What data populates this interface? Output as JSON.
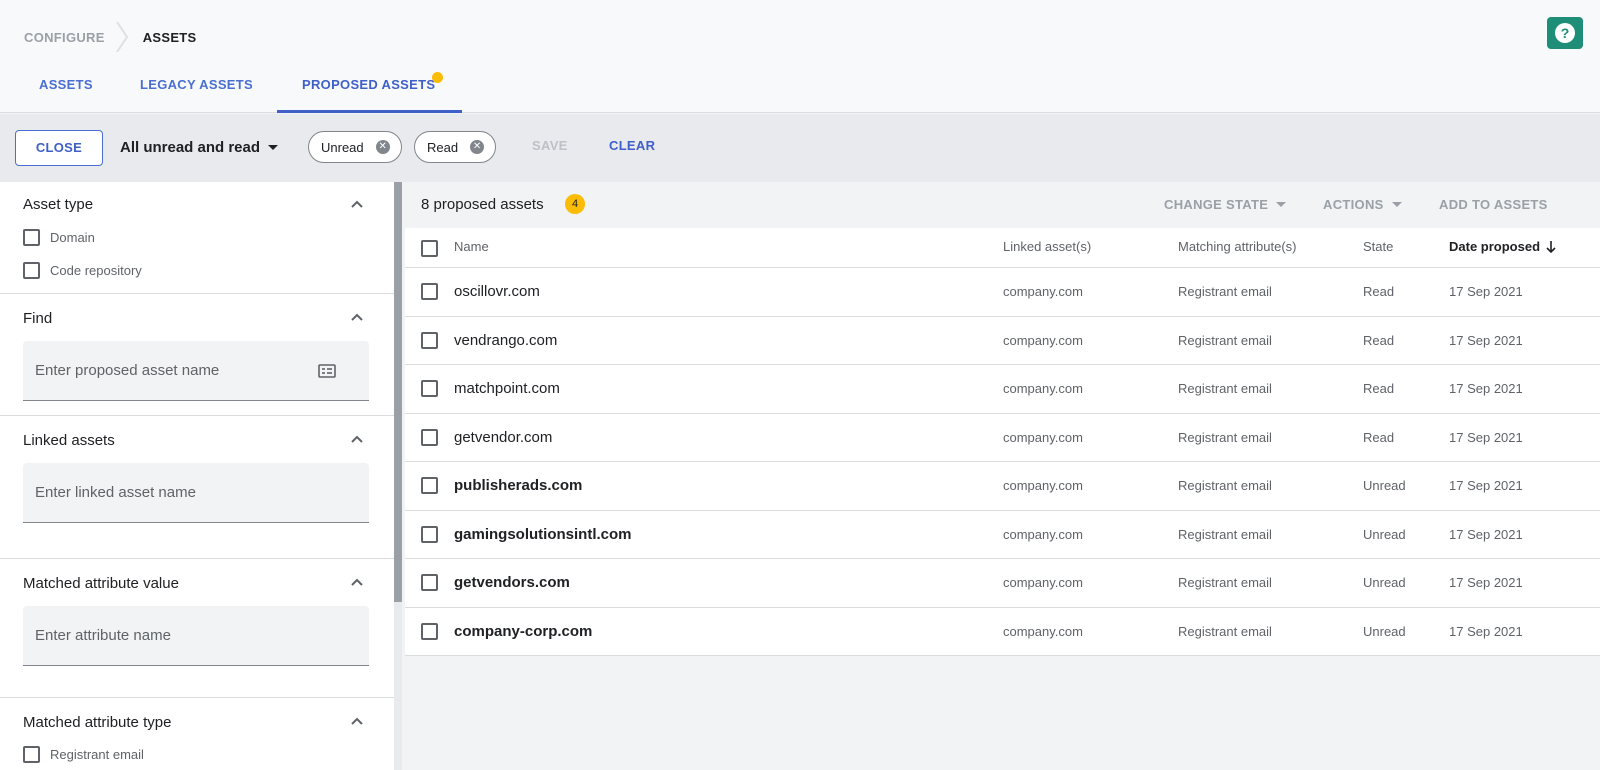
{
  "breadcrumb": {
    "parent": "CONFIGURE",
    "current": "ASSETS"
  },
  "help_label": "?",
  "tabs": [
    {
      "label": "ASSETS"
    },
    {
      "label": "LEGACY ASSETS"
    },
    {
      "label": "PROPOSED ASSETS",
      "active": true,
      "has_notification": true
    }
  ],
  "toolbar": {
    "close_label": "CLOSE",
    "filter_label": "All unread and read",
    "chips": [
      {
        "label": "Unread"
      },
      {
        "label": "Read"
      }
    ],
    "save_label": "SAVE",
    "clear_label": "CLEAR"
  },
  "sidebar": {
    "asset_type": {
      "title": "Asset type",
      "options": [
        "Domain",
        "Code repository"
      ]
    },
    "find": {
      "title": "Find",
      "placeholder": "Enter proposed asset name"
    },
    "linked": {
      "title": "Linked assets",
      "placeholder": "Enter linked asset name"
    },
    "matched_value": {
      "title": "Matched attribute value",
      "placeholder": "Enter attribute name"
    },
    "matched_type": {
      "title": "Matched attribute type",
      "options": [
        "Registrant email"
      ]
    }
  },
  "main": {
    "count_text": "8 proposed assets",
    "unread_badge": "4",
    "actions": {
      "change_state": "CHANGE STATE",
      "actions": "ACTIONS",
      "add_to_assets": "ADD TO ASSETS"
    },
    "columns": {
      "name": "Name",
      "linked": "Linked asset(s)",
      "attr": "Matching attribute(s)",
      "state": "State",
      "date": "Date proposed"
    },
    "rows": [
      {
        "name": "oscillovr.com",
        "linked": "company.com",
        "attr": "Registrant email",
        "state": "Read",
        "date": "17 Sep 2021"
      },
      {
        "name": "vendrango.com",
        "linked": "company.com",
        "attr": "Registrant email",
        "state": "Read",
        "date": "17 Sep 2021"
      },
      {
        "name": "matchpoint.com",
        "linked": "company.com",
        "attr": "Registrant email",
        "state": "Read",
        "date": "17 Sep 2021"
      },
      {
        "name": "getvendor.com",
        "linked": "company.com",
        "attr": "Registrant email",
        "state": "Read",
        "date": "17 Sep 2021"
      },
      {
        "name": "publisherads.com",
        "linked": "company.com",
        "attr": "Registrant email",
        "state": "Unread",
        "date": "17 Sep 2021"
      },
      {
        "name": "gamingsolutionsintl.com",
        "linked": "company.com",
        "attr": "Registrant email",
        "state": "Unread",
        "date": "17 Sep 2021"
      },
      {
        "name": "getvendors.com",
        "linked": "company.com",
        "attr": "Registrant email",
        "state": "Unread",
        "date": "17 Sep 2021"
      },
      {
        "name": "company-corp.com",
        "linked": "company.com",
        "attr": "Registrant email",
        "state": "Unread",
        "date": "17 Sep 2021"
      }
    ]
  },
  "colors": {
    "accent": "#3f5fc9",
    "help_button": "#1e8e78",
    "badge": "#fbbc04"
  }
}
